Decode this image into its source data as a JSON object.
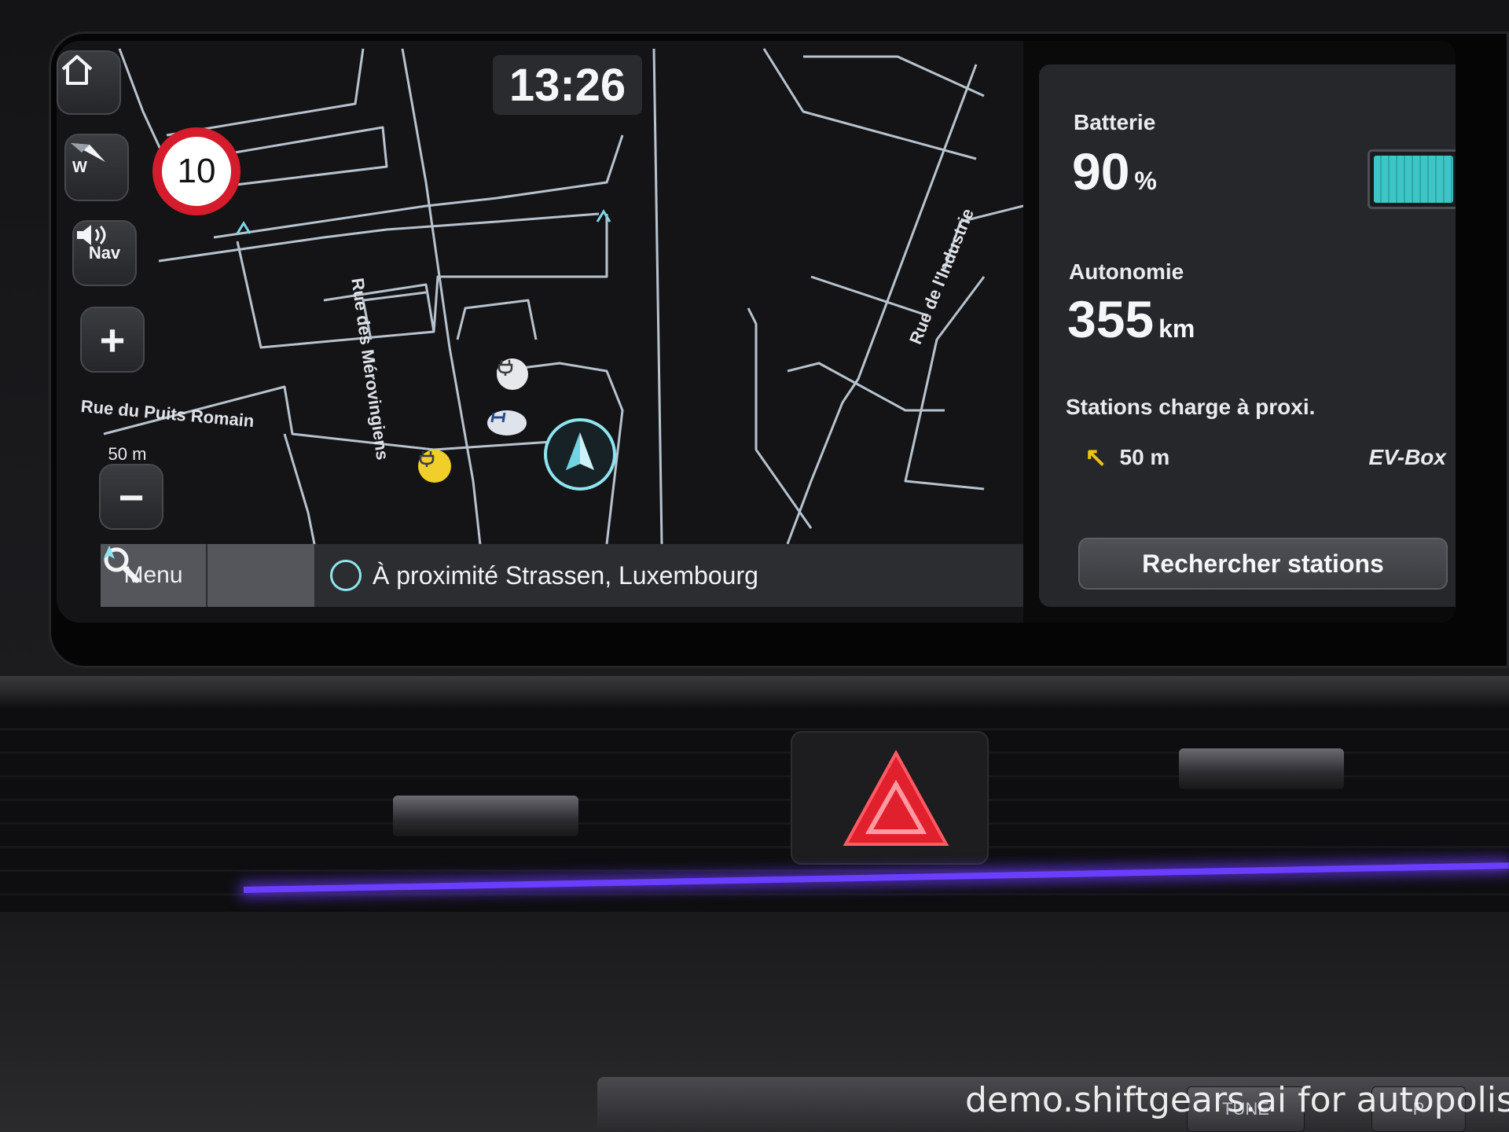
{
  "map": {
    "clock": "13:26",
    "speed_limit": "10",
    "compass_letter": "W",
    "nav_volume_label": "Nav",
    "zoom_in_symbol": "+",
    "zoom_out_symbol": "−",
    "scale_text": "50 m",
    "street_labels": {
      "merovingiens": "Rue des Mérovingiens",
      "industrie": "Rue de l'Industrie",
      "puits_romain": "Rue du Puits Romain"
    },
    "icons": {
      "home": "home-icon",
      "compass": "compass-icon",
      "speaker": "speaker-icon",
      "charging_station": "ev-charging-icon",
      "brand": "hyundai-logo-icon",
      "current_position": "navigation-arrow-icon"
    }
  },
  "bottom_bar": {
    "menu_label": "Menu",
    "search_icon": "search-icon",
    "location_text": "À proximité Strassen, Luxembourg"
  },
  "panel": {
    "battery_label": "Batterie",
    "battery_value": "90",
    "battery_unit": "%",
    "battery_level_percent": 90,
    "range_label": "Autonomie",
    "range_value": "355",
    "range_unit": "km",
    "stations_label": "Stations charge à proxi.",
    "nearest_distance": "50 m",
    "nearest_station": "EV-Box",
    "search_button": "Rechercher stations"
  },
  "car": {
    "switch_labels": [
      "TUNE",
      "P"
    ]
  },
  "watermark": "demo.shiftgears.ai for autopolis",
  "colors": {
    "accent_cyan": "#8fe5ef",
    "speed_limit_red": "#d41c2c",
    "ambient_light": "#6b3dff",
    "hazard_red": "#e0202c",
    "station_arrow": "#f1c21b"
  }
}
